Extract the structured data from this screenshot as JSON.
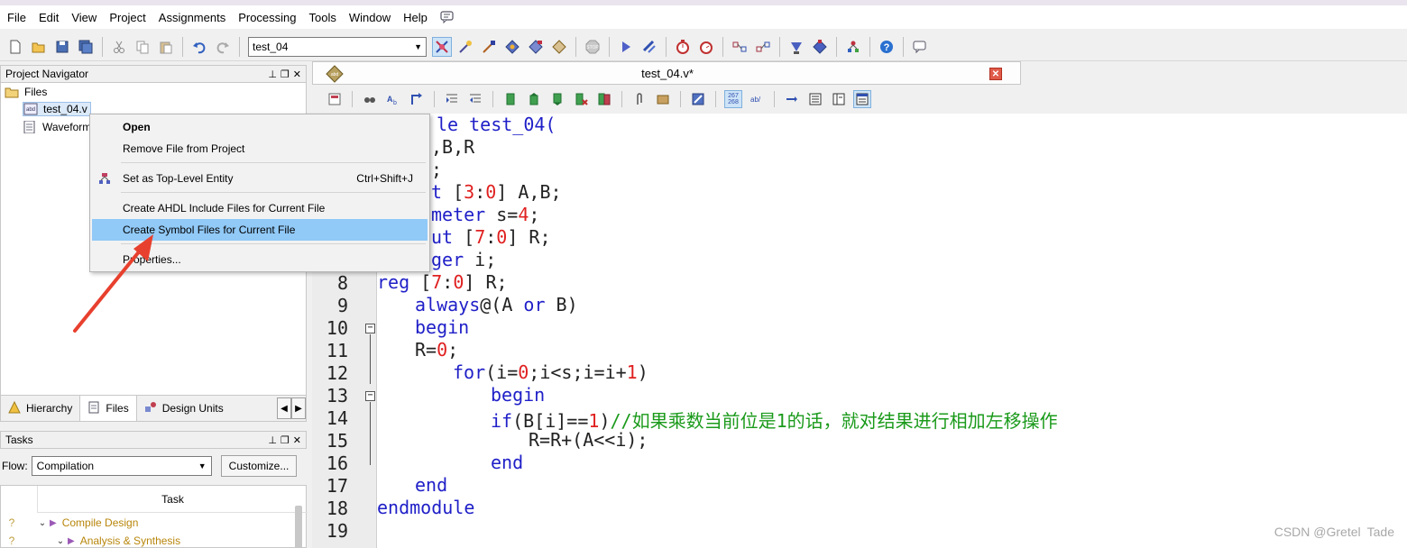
{
  "menubar": {
    "items": [
      "File",
      "Edit",
      "View",
      "Project",
      "Assignments",
      "Processing",
      "Tools",
      "Window",
      "Help"
    ]
  },
  "toolbar": {
    "project_dropdown": "test_04"
  },
  "project_navigator": {
    "title": "Project Navigator",
    "files_label": "Files",
    "items": [
      "test_04.v",
      "Waveform"
    ],
    "tabs": [
      "Hierarchy",
      "Files",
      "Design Units"
    ]
  },
  "tasks": {
    "title": "Tasks",
    "flow_label": "Flow:",
    "flow_value": "Compilation",
    "customize_button": "Customize...",
    "task_header": "Task",
    "rows": [
      "Compile Design",
      "Analysis & Synthesis"
    ]
  },
  "editor": {
    "tab_title": "test_04.v*",
    "toolbar_badge": "267\n268",
    "line_numbers": [
      "8",
      "9",
      "10",
      "11",
      "12",
      "13",
      "14",
      "15",
      "16",
      "17",
      "18",
      "19"
    ],
    "partial_lines": [
      "le test_04(",
      ",B,R",
      ";",
      "t [3:0] A,B;",
      "meter s=4;",
      "ut [7:0] R;",
      "ger i;"
    ]
  },
  "context_menu": {
    "items": [
      {
        "label": "Open",
        "bold": true
      },
      {
        "label": "Remove File from Project"
      },
      {
        "label": "Set as Top-Level Entity",
        "shortcut": "Ctrl+Shift+J"
      },
      {
        "label": "Create AHDL Include Files for Current File"
      },
      {
        "label": "Create Symbol Files for Current File",
        "highlighted": true
      },
      {
        "label": "Properties..."
      }
    ]
  },
  "code": {
    "line8": {
      "kw": "reg",
      "rest_a": " [",
      "n1": "7",
      "rest_b": ":",
      "n2": "0",
      "rest_c": "] R;"
    },
    "line9": {
      "kw": "always",
      "rest": "@(A ",
      "kw2": "or",
      "rest2": " B)"
    },
    "line10": {
      "kw": "begin"
    },
    "line11": {
      "a": "R=",
      "n": "0",
      "b": ";"
    },
    "line12": {
      "kw": "for",
      "a": "(i=",
      "n1": "0",
      "b": ";i<s;i=i+",
      "n2": "1",
      "c": ")"
    },
    "line13": {
      "kw": "begin"
    },
    "line14": {
      "kw": "if",
      "a": "(B[i]==",
      "n": "1",
      "b": ")",
      "comment": "//如果乘数当前位是1的话，就对结果进行相加左移操作"
    },
    "line15": {
      "a": "R=R+(A<<i);"
    },
    "line16": {
      "kw": "end"
    },
    "line17": {
      "kw": "end"
    },
    "line18": {
      "kw": "endmodule"
    }
  },
  "watermark": "CSDN @Gretel Tade",
  "colors": {
    "keyword": "#1f1fc8",
    "number": "#e02020",
    "comment": "#1a9a1a",
    "highlight": "#91c9f7",
    "arrow": "#e8402e"
  }
}
